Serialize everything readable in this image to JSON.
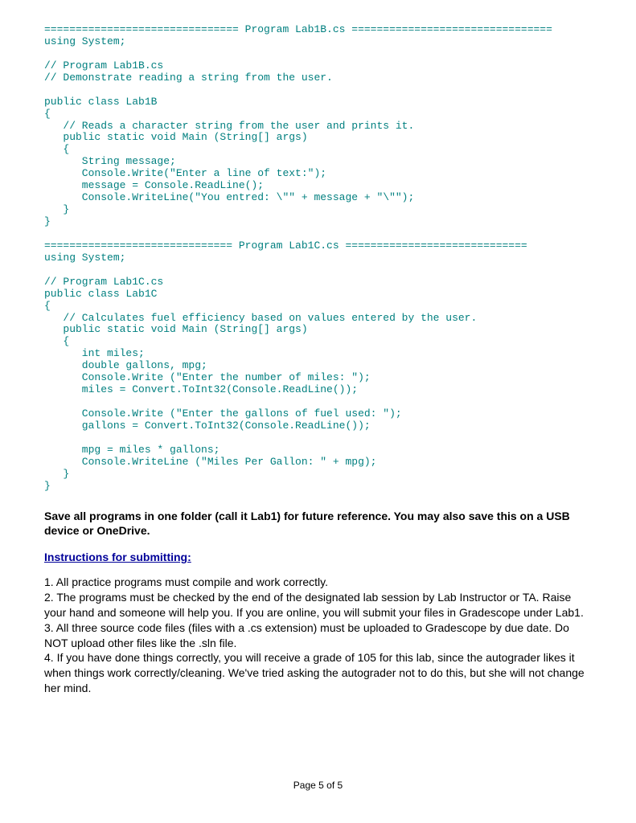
{
  "code_block": "=============================== Program Lab1B.cs ================================\nusing System;\n\n// Program Lab1B.cs\n// Demonstrate reading a string from the user.\n\npublic class Lab1B\n{\n   // Reads a character string from the user and prints it.\n   public static void Main (String[] args)\n   {\n      String message;\n      Console.Write(\"Enter a line of text:\");\n      message = Console.ReadLine();\n      Console.WriteLine(\"You entred: \\\"\" + message + \"\\\"\");\n   }\n}\n\n============================== Program Lab1C.cs =============================\nusing System;\n\n// Program Lab1C.cs\npublic class Lab1C\n{\n   // Calculates fuel efficiency based on values entered by the user.\n   public static void Main (String[] args)\n   {\n      int miles;\n      double gallons, mpg;\n      Console.Write (\"Enter the number of miles: \");\n      miles = Convert.ToInt32(Console.ReadLine());\n\n      Console.Write (\"Enter the gallons of fuel used: \");\n      gallons = Convert.ToInt32(Console.ReadLine());\n\n      mpg = miles * gallons;\n      Console.WriteLine (\"Miles Per Gallon: \" + mpg);\n   }\n}",
  "para_save": "Save all programs in one folder (call it Lab1) for future reference.  You may also save this on a USB device or OneDrive.",
  "heading_instructions": "Instructions for submitting:",
  "list_items": {
    "i1": "1. All practice programs must compile and work correctly.",
    "i2": "2. The programs must be checked by the end of the designated lab session by Lab Instructor or TA.  Raise your hand and someone will help you.  If you are online, you will submit your files in Gradescope under Lab1.",
    "i3": "3. All three source code files (files with a .cs extension) must be uploaded to Gradescope by due date.  Do NOT upload other files like the .sln file.",
    "i4": "4. If you have done things correctly, you will receive a grade of 105 for this lab, since the autograder likes it when things work correctly/cleaning.   We've tried asking the autograder not to do this, but she will not change her mind."
  },
  "footer": "Page 5 of 5"
}
